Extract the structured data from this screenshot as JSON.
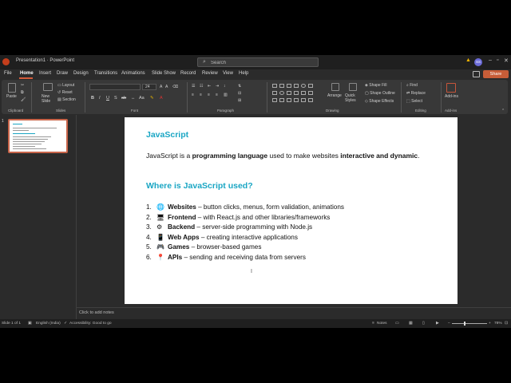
{
  "titlebar": {
    "title": "Presentation1 · PowerPoint",
    "search_placeholder": "Search",
    "avatar_initials": "SS"
  },
  "menu": {
    "items": [
      "File",
      "Home",
      "Insert",
      "Draw",
      "Design",
      "Transitions",
      "Animations",
      "Slide Show",
      "Record",
      "Review",
      "View",
      "Help"
    ],
    "active": "Home",
    "share_label": "Share"
  },
  "ribbon": {
    "paste": "Paste",
    "new_slide": "New Slide",
    "layout": "Layout",
    "reset": "Reset",
    "section": "Section",
    "font_size": "24",
    "arrange": "Arrange",
    "quick_styles": "Quick Styles",
    "shape_fill": "Shape Fill",
    "shape_outline": "Shape Outline",
    "shape_effects": "Shape Effects",
    "find": "Find",
    "replace": "Replace",
    "select": "Select",
    "addins": "Add-ins",
    "groups": {
      "clipboard": "Clipboard",
      "slides": "Slides",
      "font": "Font",
      "paragraph": "Paragraph",
      "drawing": "Drawing",
      "editing": "Editing",
      "addins": "Add-ins"
    }
  },
  "thumbnail": {
    "number": "1"
  },
  "slide": {
    "title": "JavaScript",
    "intro_1": "JavaScript is a ",
    "intro_2": "programming language",
    "intro_3": " used to make websites ",
    "intro_4": "interactive and dynamic",
    "intro_5": ".",
    "subtitle": "Where is JavaScript used?",
    "items": [
      {
        "num": "1.",
        "icon": "🌐",
        "bold": "Websites",
        "rest": " – button clicks, menus, form validation, animations"
      },
      {
        "num": "2.",
        "icon": "🖥",
        "bold": "Frontend",
        "rest": " – with React.js and other libraries/frameworks"
      },
      {
        "num": "3.",
        "icon": "⚙",
        "bold": "Backend",
        "rest": " – server-side programming with Node.js"
      },
      {
        "num": "4.",
        "icon": "📱",
        "bold": "Web Apps",
        "rest": " – creating interactive applications"
      },
      {
        "num": "5.",
        "icon": "🎮",
        "bold": "Games",
        "rest": " – browser-based games"
      },
      {
        "num": "6.",
        "icon": "📍",
        "bold": "APIs",
        "rest": " – sending and receiving data from servers"
      }
    ]
  },
  "notes": {
    "placeholder": "Click to add notes"
  },
  "status": {
    "slide_count": "Slide 1 of 1",
    "language": "English (India)",
    "accessibility": "Accessibility: Good to go",
    "notes": "Notes",
    "zoom": "78%"
  }
}
